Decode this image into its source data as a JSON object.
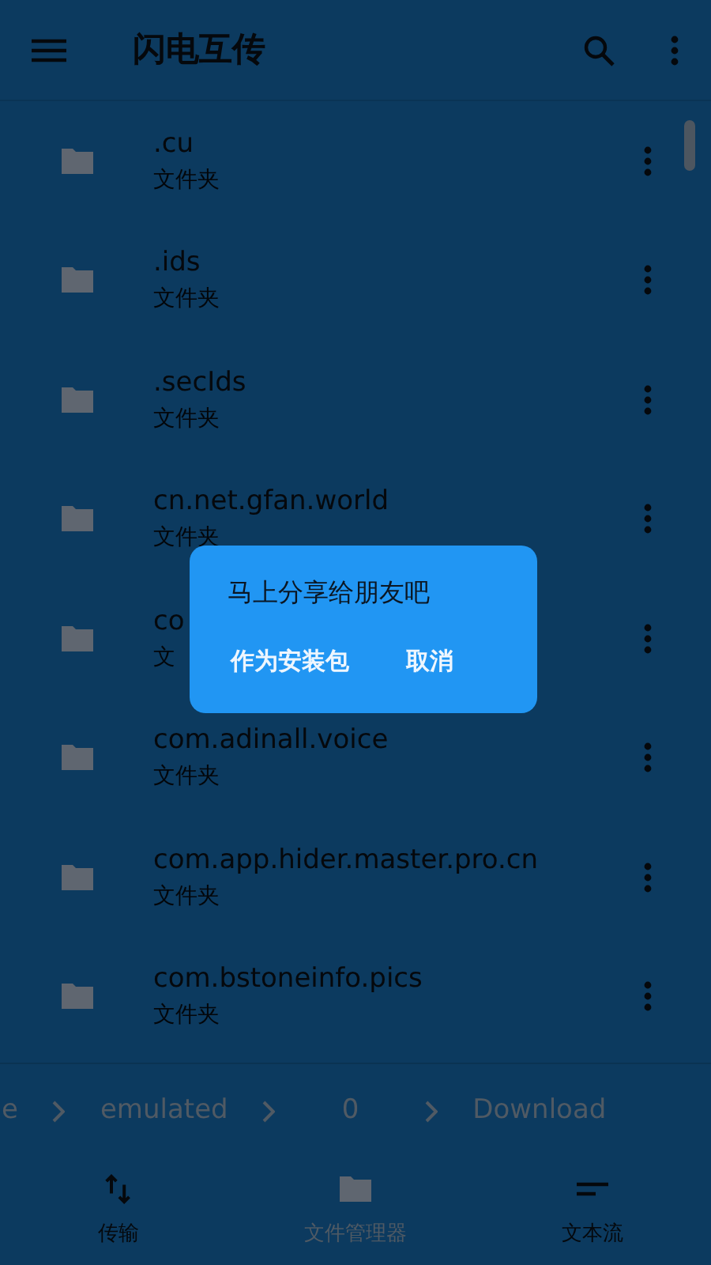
{
  "app_bar": {
    "title": "闪电互传"
  },
  "files": [
    {
      "name": ".cu",
      "subtitle": "文件夹"
    },
    {
      "name": ".ids",
      "subtitle": "文件夹"
    },
    {
      "name": ".secIds",
      "subtitle": "文件夹"
    },
    {
      "name": "cn.net.gfan.world",
      "subtitle": "文件夹"
    },
    {
      "name": "co",
      "subtitle": "文"
    },
    {
      "name": "com.adinall.voice",
      "subtitle": "文件夹"
    },
    {
      "name": "com.app.hider.master.pro.cn",
      "subtitle": "文件夹"
    },
    {
      "name": "com.bstoneinfo.pics",
      "subtitle": "文件夹"
    }
  ],
  "breadcrumb": [
    "e",
    "emulated",
    "0",
    "Download"
  ],
  "bottom_nav": [
    {
      "label": "传输",
      "kind": "transfer",
      "selected": false
    },
    {
      "label": "文件管理器",
      "kind": "folder",
      "selected": true
    },
    {
      "label": "文本流",
      "kind": "text",
      "selected": false
    }
  ],
  "dialog": {
    "message": "马上分享给朋友吧",
    "buttons": [
      "作为安装包",
      "取消"
    ]
  }
}
